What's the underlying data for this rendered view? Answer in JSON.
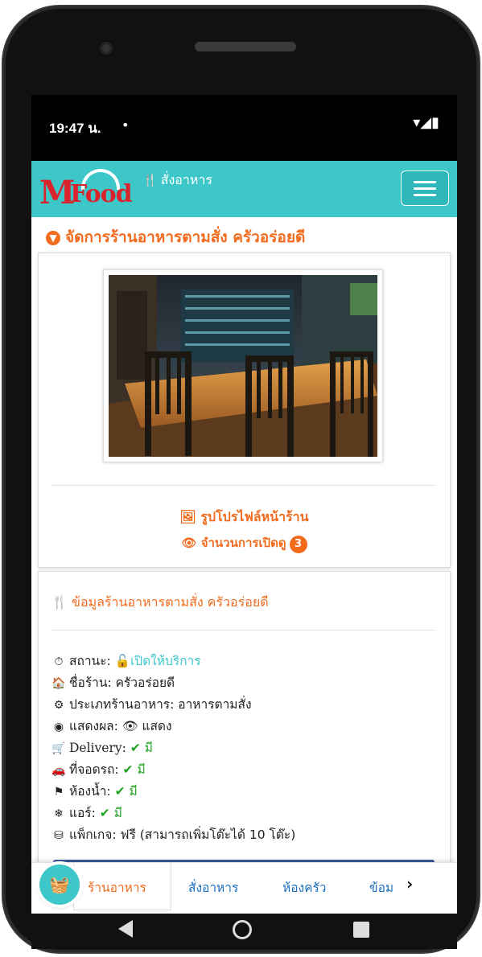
{
  "status_bar": {
    "time": "19:47 น.",
    "dot": "•",
    "icons": "▾◢▮"
  },
  "navbar": {
    "logo_m": "M",
    "logo_food": "Food",
    "order_label": "สั่งอาหาร",
    "fork_icon": "🍴"
  },
  "page": {
    "title": "จัดการร้านอาหารตามสั่ง ครัวอร่อยดี"
  },
  "profile": {
    "link_label": "รูปโปรไฟล์หน้าร้าน",
    "views_label": "จำนวนการเปิดดู",
    "views_count": "3"
  },
  "info": {
    "heading": "ข้อมูลร้านอาหารตามสั่ง ครัวอร่อยดี",
    "status_label": "สถานะ:",
    "status_value": "เปิดให้บริการ",
    "name_label": "ชื่อร้าน:",
    "name_value": "ครัวอร่อยดี",
    "type_label": "ประเภทร้านอาหาร:",
    "type_value": "อาหารตามสั่ง",
    "display_label": "แสดงผล:",
    "display_value": "แสดง",
    "delivery_label": "Delivery:",
    "delivery_value": "มี",
    "parking_label": "ที่จอดรถ:",
    "parking_value": "มี",
    "toilet_label": "ห้องน้ำ:",
    "toilet_value": "มี",
    "air_label": "แอร์:",
    "air_value": "มี",
    "package_label": "แพ็กเกจ:",
    "package_value": "ฟรี (สามารถเพิ่มโต๊ะได้ 10 โต๊ะ)"
  },
  "tabs": [
    {
      "label": "ร้านอาหาร",
      "active": true
    },
    {
      "label": "สั่งอาหาร",
      "active": false
    },
    {
      "label": "ห้องครัว",
      "active": false
    },
    {
      "label": "ข้อม",
      "active": false
    }
  ],
  "colors": {
    "accent": "#3ec7c9",
    "orange": "#f26b1d",
    "green": "#23a323",
    "brand_red": "#d9232d"
  }
}
